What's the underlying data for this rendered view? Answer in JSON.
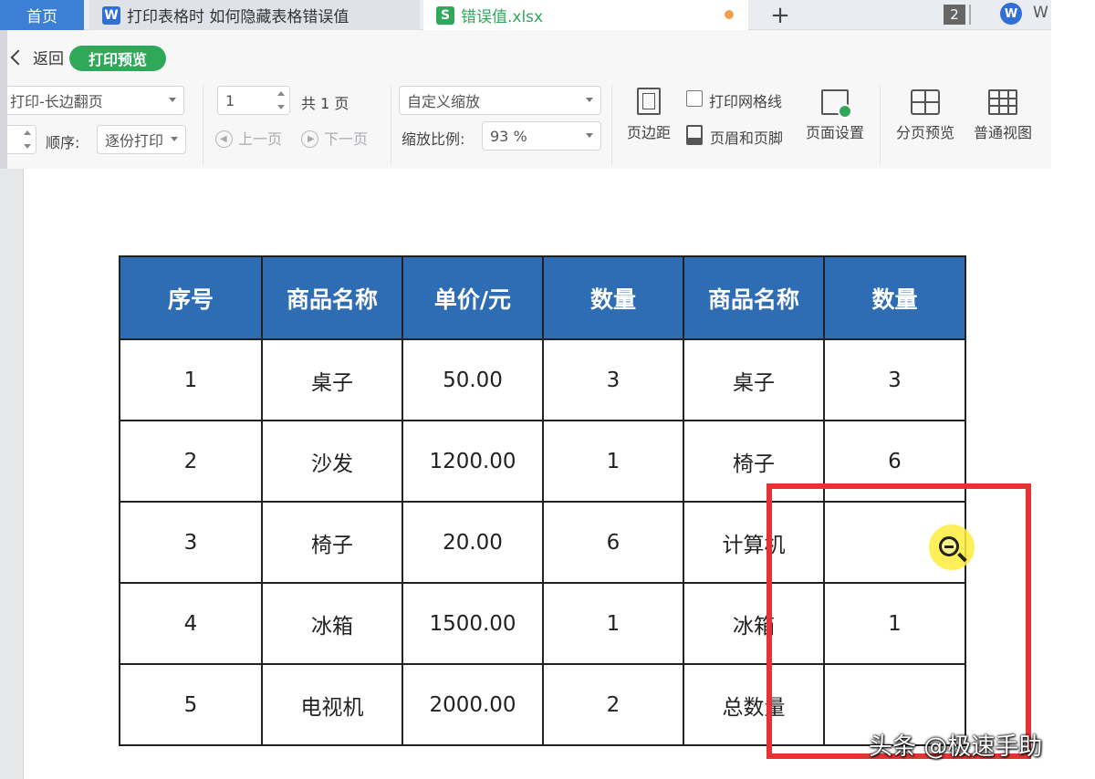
{
  "tabs": {
    "home": "首页",
    "doc": {
      "badge": "W",
      "title": "打印表格时 如何隐藏表格错误值"
    },
    "xls": {
      "badge": "S",
      "title": "错误值.xlsx"
    },
    "plus": "+",
    "window_count": "2",
    "wps_logo": "W",
    "account_letter": "W"
  },
  "toolbar": {
    "back": "返回",
    "mode_badge": "打印预览",
    "print_mode": "打印-长边翻页",
    "order_label": "顺序:",
    "order_value": "逐份打印",
    "page_input": "1",
    "page_total": "共 1 页",
    "prev_page": "上一页",
    "next_page": "下一页",
    "scale_mode": "自定义缩放",
    "scale_label": "缩放比例:",
    "scale_value": "93 %",
    "print_gridlines": "打印网格线",
    "margins": "页边距",
    "header_footer": "页眉和页脚",
    "page_setup": "页面设置",
    "page_break_preview": "分页预览",
    "normal_view": "普通视图"
  },
  "table": {
    "headers": [
      "序号",
      "商品名称",
      "单价/元",
      "数量",
      "商品名称",
      "数量"
    ],
    "rows": [
      [
        "1",
        "桌子",
        "50.00",
        "3",
        "桌子",
        "3"
      ],
      [
        "2",
        "沙发",
        "1200.00",
        "1",
        "椅子",
        "6"
      ],
      [
        "3",
        "椅子",
        "20.00",
        "6",
        "计算机",
        ""
      ],
      [
        "4",
        "冰箱",
        "1500.00",
        "1",
        "冰箱",
        "1"
      ],
      [
        "5",
        "电视机",
        "2000.00",
        "2",
        "总数量",
        ""
      ]
    ]
  },
  "watermark": "头条 @极速手助",
  "colors": {
    "header_fill": "#2e6db4",
    "highlight_box": "#e83232",
    "brand_green": "#2fa85a",
    "brand_blue": "#2f6fd6"
  }
}
